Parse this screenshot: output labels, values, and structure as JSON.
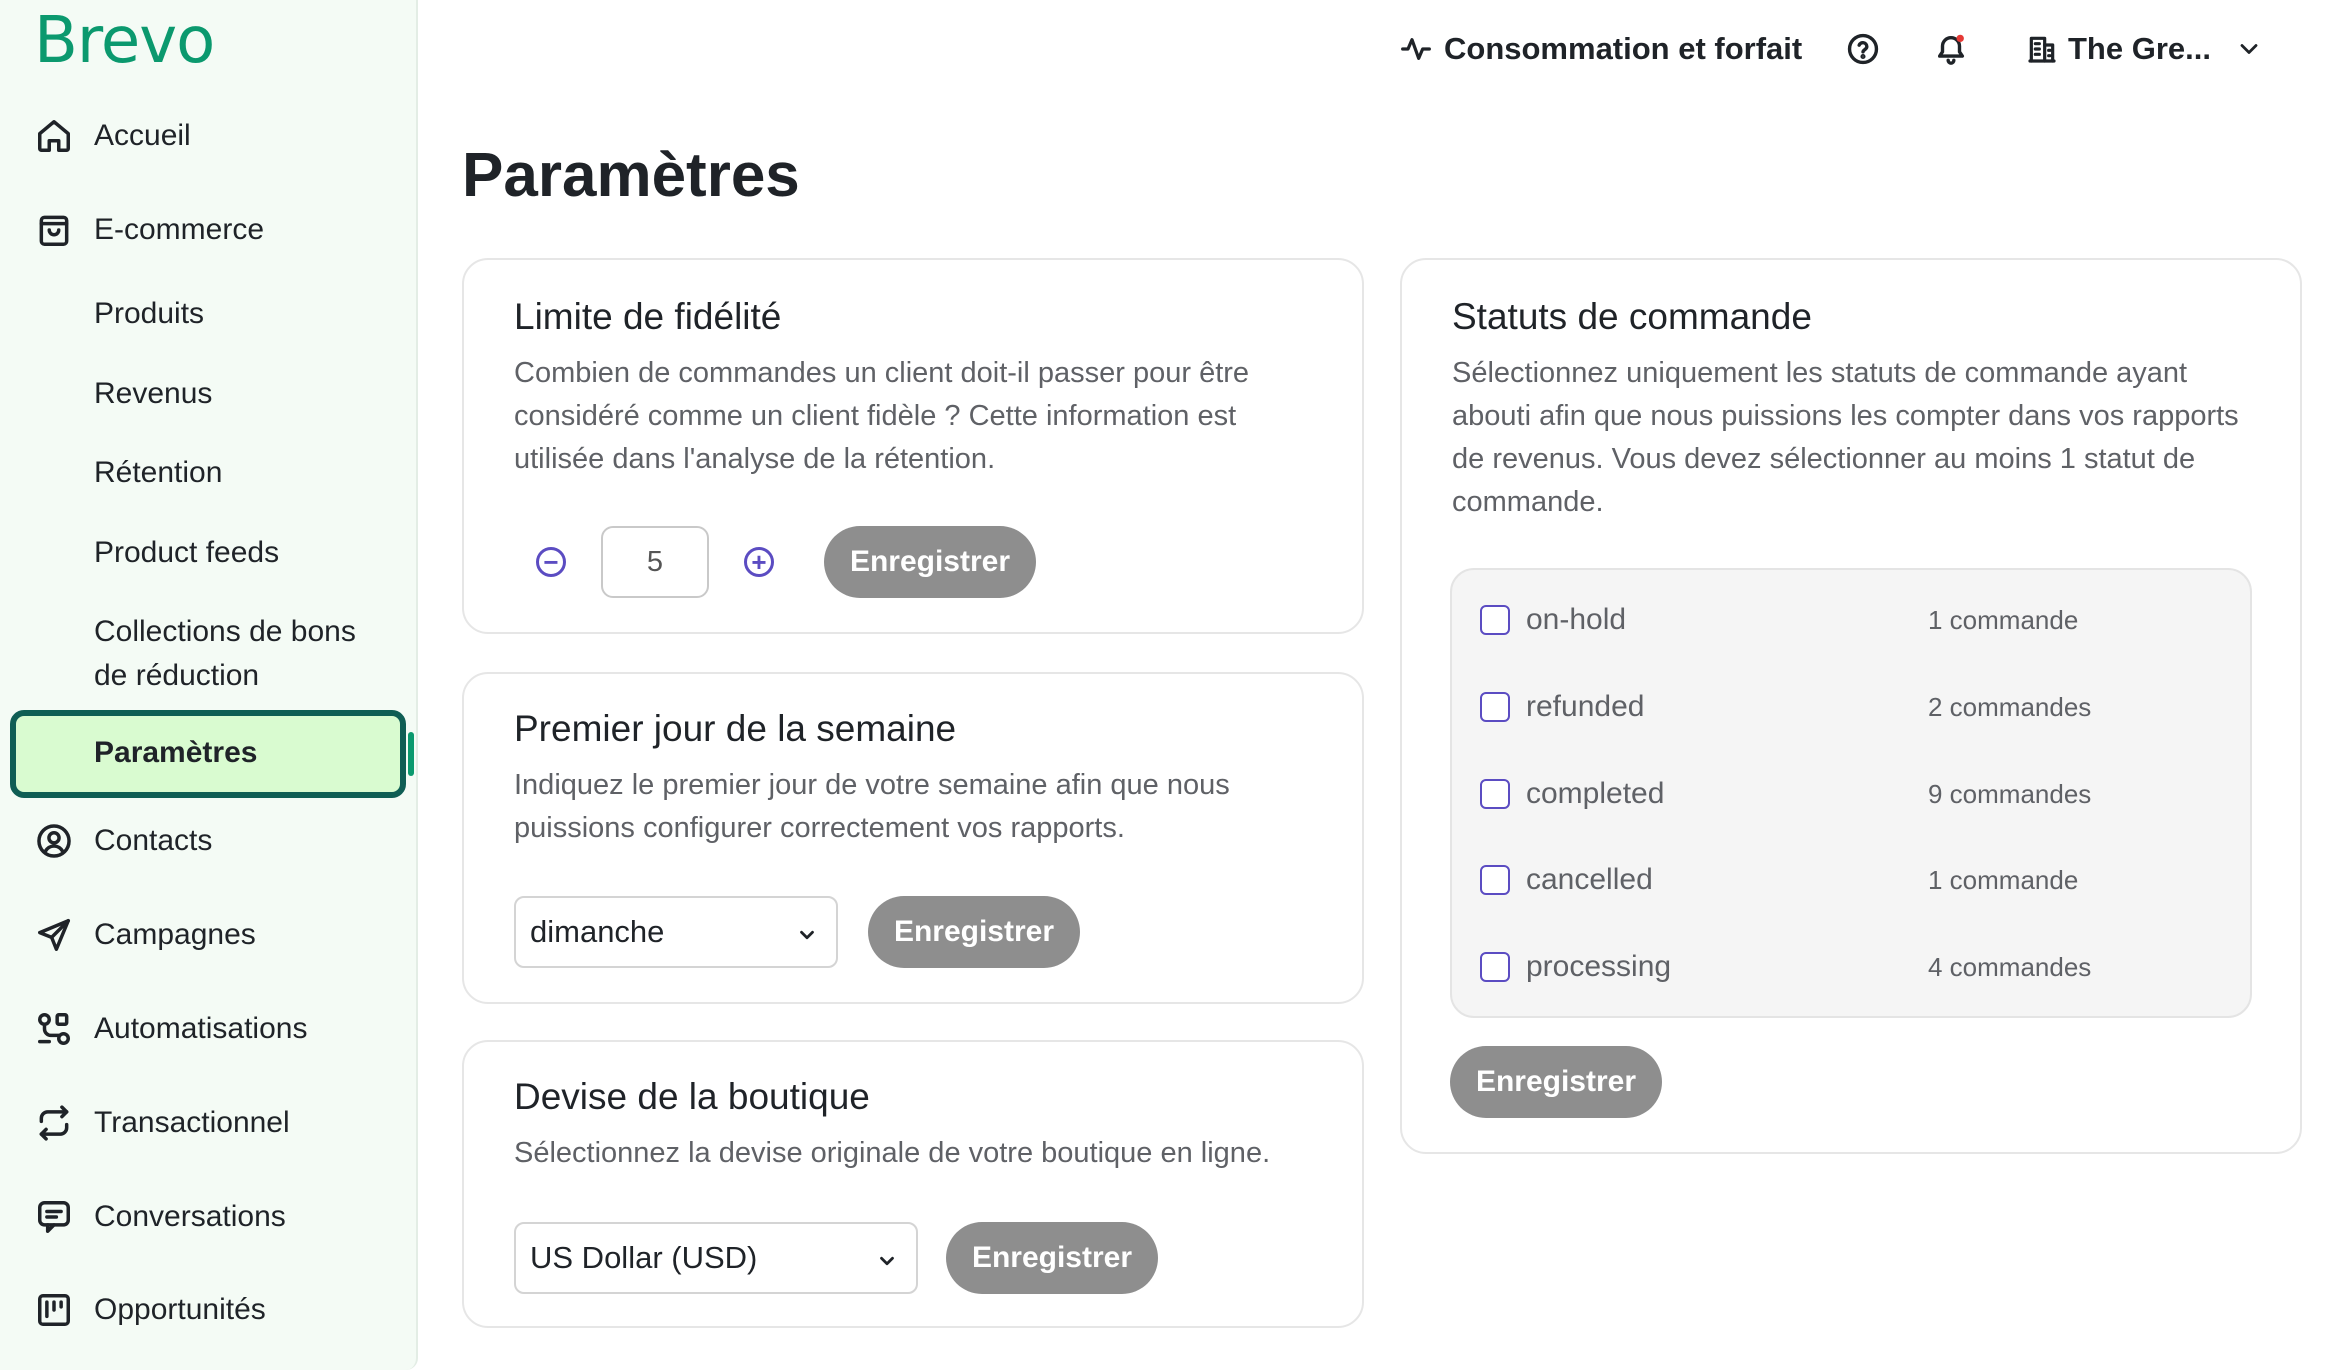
{
  "brand": "Brevo",
  "sidebar": {
    "items": [
      {
        "label": "Accueil",
        "icon": "home-icon"
      },
      {
        "label": "E-commerce",
        "icon": "shopping-bag-icon"
      },
      {
        "label": "Contacts",
        "icon": "contact-icon"
      },
      {
        "label": "Campagnes",
        "icon": "send-icon"
      },
      {
        "label": "Automatisations",
        "icon": "automation-icon"
      },
      {
        "label": "Transactionnel",
        "icon": "repeat-icon"
      },
      {
        "label": "Conversations",
        "icon": "chat-icon"
      },
      {
        "label": "Opportunités",
        "icon": "kanban-icon"
      }
    ],
    "ecommerce_sub": {
      "produits": "Produits",
      "revenus": "Revenus",
      "retention": "Rétention",
      "product_feeds": "Product feeds",
      "collections_line1": "Collections de bons",
      "collections_line2": "de réduction",
      "parametres": "Paramètres"
    }
  },
  "header": {
    "usage_label": "Consommation et forfait",
    "account_label": "The Gre..."
  },
  "page": {
    "title": "Paramètres"
  },
  "loyalty": {
    "title": "Limite de fidélité",
    "description": "Combien de commandes un client doit-il passer pour être considéré comme un client fidèle ? Cette information est utilisée dans l'analyse de la rétention.",
    "value": "5",
    "save_label": "Enregistrer"
  },
  "week": {
    "title": "Premier jour de la semaine",
    "description": "Indiquez le premier jour de votre semaine afin que nous puissions configurer correctement vos rapports.",
    "selected": "dimanche",
    "save_label": "Enregistrer"
  },
  "currency": {
    "title": "Devise de la boutique",
    "description": "Sélectionnez la devise originale de votre boutique en ligne.",
    "selected": "US Dollar (USD)",
    "save_label": "Enregistrer"
  },
  "order_status": {
    "title": "Statuts de commande",
    "description": "Sélectionnez uniquement les statuts de commande ayant abouti afin que nous puissions les compter dans vos rapports de revenus. Vous devez sélectionner au moins 1 statut de commande.",
    "statuses": [
      {
        "name": "on-hold",
        "count": "1 commande"
      },
      {
        "name": "refunded",
        "count": "2 commandes"
      },
      {
        "name": "completed",
        "count": "9 commandes"
      },
      {
        "name": "cancelled",
        "count": "1 commande"
      },
      {
        "name": "processing",
        "count": "4 commandes"
      }
    ],
    "save_label": "Enregistrer"
  },
  "colors": {
    "brand_green": "#0b996e",
    "active_bg": "#d9fbd0",
    "active_border": "#0f5e54",
    "accent_purple": "#5b4cc2",
    "button_disabled": "#8e8e8e"
  }
}
